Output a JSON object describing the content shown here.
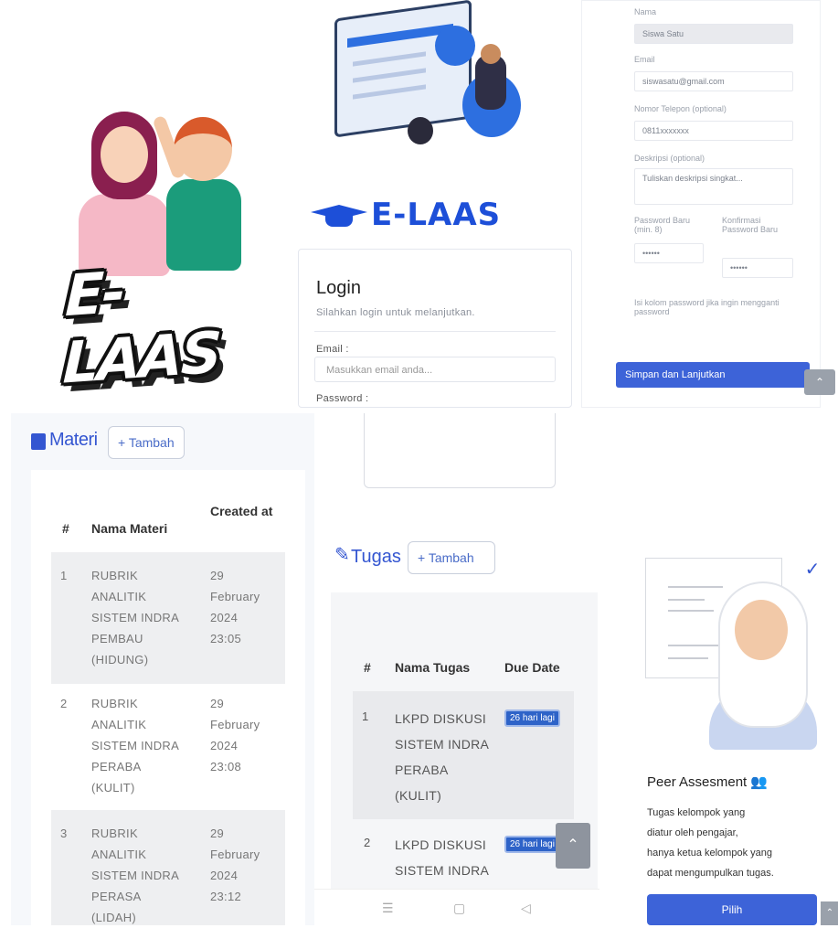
{
  "logo_panel": {
    "logo_text": "E-LAAS"
  },
  "login_panel": {
    "brand": "E-LAAS",
    "title": "Login",
    "subtitle": "Silahkan login untuk melanjutkan.",
    "email_label": "Email :",
    "email_placeholder": "Masukkan email anda...",
    "password_label": "Password :"
  },
  "profile_form": {
    "name_label": "Nama",
    "name_value": "Siswa Satu",
    "email_label": "Email",
    "email_value": "siswasatu@gmail.com",
    "phone_label": "Nomor Telepon (optional)",
    "phone_value": "0811xxxxxxx",
    "desc_label": "Deskripsi (optional)",
    "desc_value": "Tuliskan deskripsi singkat...",
    "password_label": "Password Baru (min. 8)",
    "password_value": "••••••",
    "confirm_label": "Konfirmasi Password Baru",
    "confirm_value": "••••••",
    "note": "Isi kolom password jika ingin mengganti password",
    "save_button": "Simpan dan Lanjutkan",
    "scroll_icon": "chevron-up-icon"
  },
  "materi": {
    "title": "Materi",
    "add_button": "+ Tambah",
    "columns": [
      "#",
      "Nama Materi",
      "Created at"
    ],
    "rows": [
      {
        "no": "1",
        "name": [
          "RUBRIK",
          "ANALITIK",
          "SISTEM INDRA",
          "PEMBAU",
          "(HIDUNG)"
        ],
        "created": [
          "29",
          "February",
          "2024",
          "23:05"
        ]
      },
      {
        "no": "2",
        "name": [
          "RUBRIK",
          "ANALITIK",
          "SISTEM INDRA",
          "PERABA",
          "(KULIT)"
        ],
        "created": [
          "29",
          "February",
          "2024",
          "23:08"
        ]
      },
      {
        "no": "3",
        "name": [
          "RUBRIK",
          "ANALITIK",
          "SISTEM INDRA",
          "PERASA",
          "(LIDAH)"
        ],
        "created": [
          "29",
          "February",
          "2024",
          "23:12"
        ]
      }
    ]
  },
  "tugas": {
    "title": "Tugas",
    "add_button": "+ Tambah",
    "columns": [
      "#",
      "Nama Tugas",
      "Due Date"
    ],
    "rows": [
      {
        "no": "1",
        "name": [
          "LKPD DISKUSI",
          "SISTEM INDRA",
          "PERABA",
          "(KULIT)"
        ],
        "due": "26 hari lagi"
      },
      {
        "no": "2",
        "name": [
          "LKPD DISKUSI",
          "SISTEM INDRA"
        ],
        "due": "26 hari lagi"
      }
    ],
    "nav": {
      "menu": "☰",
      "home": "▢",
      "back": "◁"
    }
  },
  "peer": {
    "title": "Peer Assesment",
    "text": [
      "Tugas kelompok yang",
      "diatur oleh pengajar,",
      "hanya ketua kelompok yang",
      "dapat mengumpulkan tugas."
    ],
    "button": "Pilih"
  },
  "colors": {
    "primary": "#3456d1",
    "button": "#3d63d8",
    "brand": "#1d4fd8"
  }
}
